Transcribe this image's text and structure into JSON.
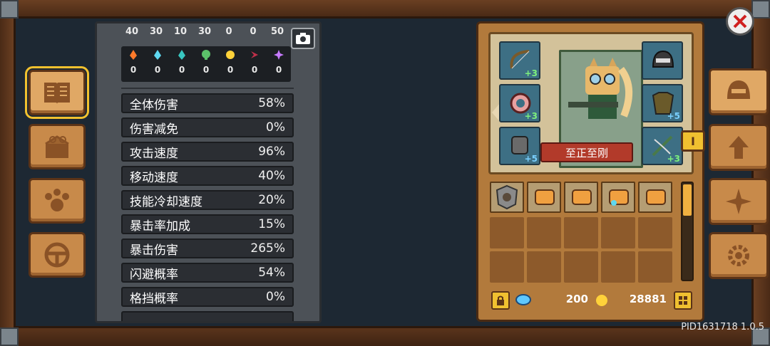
{
  "resources_top": [
    "40",
    "30",
    "10",
    "30",
    "0",
    "0",
    "50"
  ],
  "elements": [
    {
      "icon": "fire-icon",
      "color": "#ff7a2a",
      "value": "0"
    },
    {
      "icon": "ice-icon",
      "color": "#5fd8f0",
      "value": "0"
    },
    {
      "icon": "water-icon",
      "color": "#38c6c0",
      "value": "0"
    },
    {
      "icon": "poison-icon",
      "color": "#5cc26a",
      "value": "0"
    },
    {
      "icon": "lightning-icon",
      "color": "#ffd23a",
      "value": "0"
    },
    {
      "icon": "dark-icon",
      "color": "#c0304a",
      "value": "0"
    },
    {
      "icon": "arcane-icon",
      "color": "#c77bff",
      "value": "0"
    }
  ],
  "stats": [
    {
      "label": "全体伤害",
      "value": "58%"
    },
    {
      "label": "伤害减免",
      "value": "0%"
    },
    {
      "label": "攻击速度",
      "value": "96%"
    },
    {
      "label": "移动速度",
      "value": "40%"
    },
    {
      "label": "技能冷却速度",
      "value": "20%"
    },
    {
      "label": "暴击率加成",
      "value": "15%"
    },
    {
      "label": "暴击伤害",
      "value": "265%"
    },
    {
      "label": "闪避概率",
      "value": "54%"
    },
    {
      "label": "格挡概率",
      "value": "0%"
    }
  ],
  "equipment": {
    "left": [
      {
        "icon": "bow-icon",
        "level": "+3"
      },
      {
        "icon": "ring-icon",
        "level": "+3"
      },
      {
        "icon": "gauntlet-icon",
        "level": "+5"
      }
    ],
    "right": [
      {
        "icon": "helmet-icon",
        "level": ""
      },
      {
        "icon": "armor-icon",
        "level": "+5"
      },
      {
        "icon": "crossbow-icon",
        "level": "+3"
      }
    ]
  },
  "character_name": "至正至刚",
  "level_tag": "I",
  "currency": {
    "gems": "200",
    "gold": "28881"
  },
  "version_text": "PID1631718 1.0.5",
  "colors": {
    "accent": "#f0c030",
    "panel": "#4c5157",
    "wood": "#c88a4a"
  }
}
